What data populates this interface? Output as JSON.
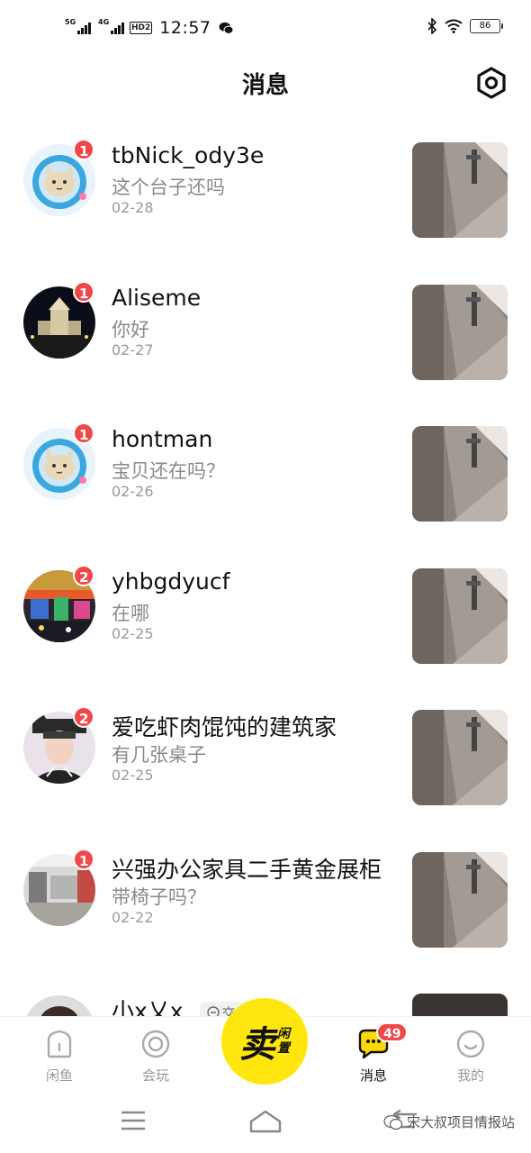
{
  "status_bar": {
    "time": "12:57",
    "network1": "5G",
    "network2": "4G",
    "hd": "HD2",
    "battery": "86"
  },
  "header": {
    "title": "消息",
    "settings_icon": "settings-hexagon-icon"
  },
  "messages": [
    {
      "name": "tbNick_ody3e",
      "preview": "这个台子还吗",
      "date": "02-28",
      "badge": "1",
      "avatar": "cat-astronaut"
    },
    {
      "name": "Aliseme",
      "preview": "你好",
      "date": "02-27",
      "badge": "1",
      "avatar": "night-building"
    },
    {
      "name": "hontman",
      "preview": "宝贝还在吗？",
      "date": "02-26",
      "badge": "1",
      "avatar": "cat-astronaut"
    },
    {
      "name": "yhbgdyucf",
      "preview": "在哪",
      "date": "02-25",
      "badge": "2",
      "avatar": "colorful-street"
    },
    {
      "name": "爱吃虾肉馄饨的建筑家",
      "preview": "有几张桌子",
      "date": "02-25",
      "badge": "2",
      "avatar": "person-cat-ears"
    },
    {
      "name": "兴强办公家具二手黄金展柜",
      "preview": "带椅子吗？",
      "date": "02-22",
      "badge": "1",
      "avatar": "office-room"
    },
    {
      "name": "小x乂x",
      "preview": "",
      "date": "",
      "badge": "",
      "avatar": "person",
      "tag": "交易"
    }
  ],
  "tabs": {
    "home": "闲鱼",
    "play": "会玩",
    "sell_main": "卖",
    "sell_sub1": "闲",
    "sell_sub2": "置",
    "messages": "消息",
    "messages_badge": "49",
    "mine": "我的"
  },
  "watermark": "宋大叔项目情报站",
  "colors": {
    "accent_yellow": "#ffe60f",
    "badge_red": "#f04848"
  }
}
